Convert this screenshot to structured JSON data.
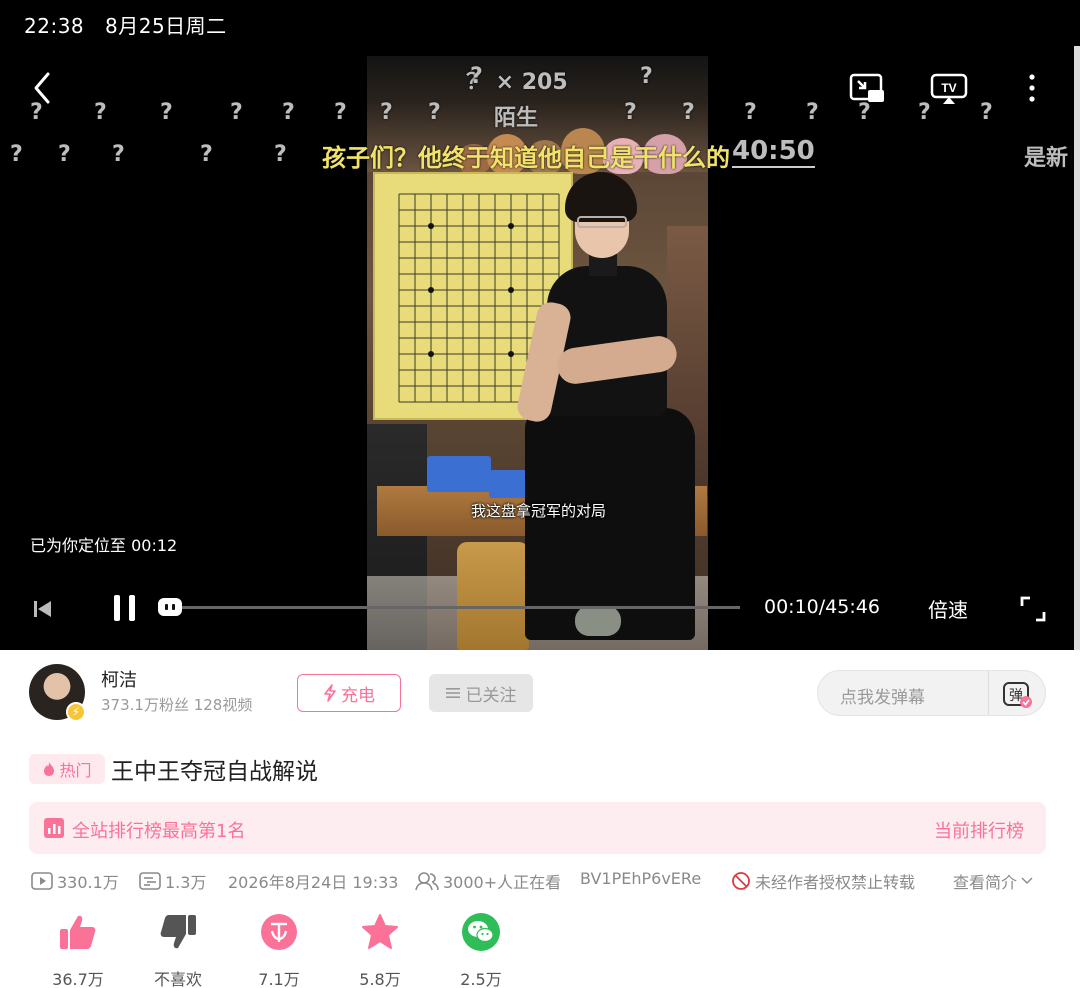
{
  "status_bar": {
    "time": "22:38",
    "date": "8月25日周二"
  },
  "player": {
    "danmaku": [
      {
        "text": "？ × 205",
        "cls": "gray"
      },
      {
        "text": "陌生",
        "cls": "gray"
      },
      {
        "text": "孩子们？他终于知道他自己是干什么的",
        "cls": "yellow"
      },
      {
        "text": "40:50",
        "cls": "gray"
      },
      {
        "text": "是新",
        "cls": "gray"
      }
    ],
    "subtitle": "我这盘拿冠军的对局",
    "seek_toast": "已为你定位至 00:12",
    "time": "00:10/45:46",
    "progress_fraction": 0.0036,
    "speed_label": "倍速",
    "icons": {
      "back": "chevron-left-icon",
      "cast": "picture-in-picture-icon",
      "tv": "tv-cast-icon",
      "more": "more-vertical-icon"
    }
  },
  "author": {
    "name": "柯洁",
    "stats": "373.1万粉丝 128视频",
    "charge_label": "充电",
    "follow_label": "已关注"
  },
  "danmu_input": {
    "placeholder": "点我发弹幕",
    "toggle_label": "弹"
  },
  "video": {
    "hot_tag": "热门",
    "title": "王中王夺冠自战解说",
    "rank_text": "全站排行榜最高第1名",
    "rank_link": "当前排行榜",
    "meta": {
      "views": "330.1万",
      "danmaku_count": "1.3万",
      "publish_time": "2026年8月24日 19:33",
      "watching": "3000+人正在看",
      "bvid": "BV1PEhP6vERe",
      "copyright": "未经作者授权禁止转载",
      "intro": "查看简介"
    }
  },
  "actions": {
    "like": "36.7万",
    "dislike": "不喜欢",
    "coin": "7.1万",
    "favorite": "5.8万",
    "share": "2.5万"
  },
  "colors": {
    "accent": "#fb7299",
    "share_green": "#2ebd58",
    "player_bg": "#000000"
  }
}
